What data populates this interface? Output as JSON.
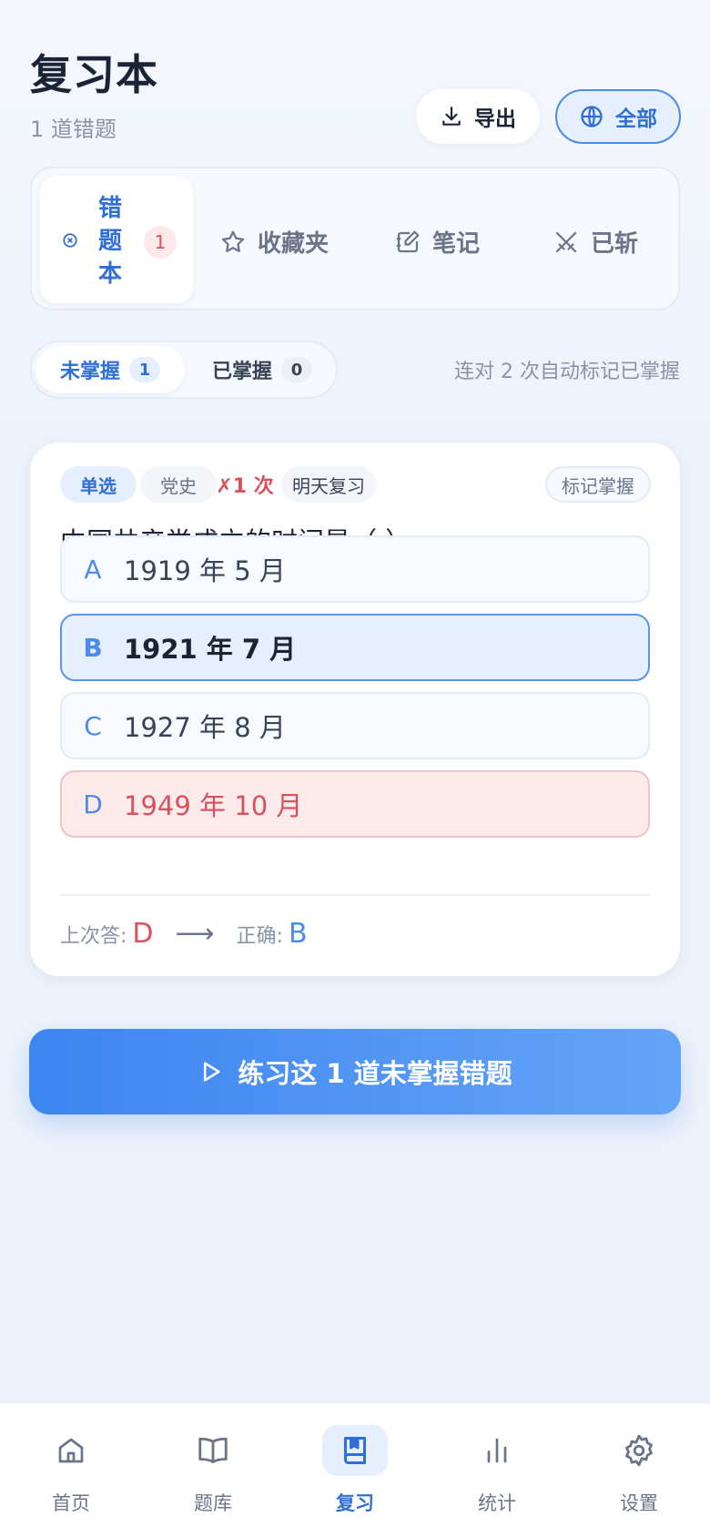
{
  "header": {
    "title": "复习本",
    "subtitle": "1 道错题",
    "export_label": "导出",
    "filter_label": "全部"
  },
  "tabs": {
    "active": {
      "label": "错题本",
      "count": "1",
      "icon": "x-circle-icon"
    },
    "items": [
      {
        "label": "收藏夹",
        "icon": "star-icon"
      },
      {
        "label": "笔记",
        "icon": "edit-icon"
      },
      {
        "label": "已斩",
        "icon": "crossed-swords-icon"
      }
    ]
  },
  "mastery_filter": {
    "unmastered_label": "未掌握",
    "unmastered_count": "1",
    "mastered_label": "已掌握",
    "mastered_count": "0",
    "hint": "连对 2 次自动标记已掌握"
  },
  "question": {
    "type_tag": "单选",
    "subject_tag": "党史",
    "wrong_count": "✗1 次",
    "review_tag": "明天复习",
    "mark_label": "标记掌握",
    "text": "中国共产党成立的时间是（ ）。",
    "options": [
      {
        "letter": "A",
        "text": "1919 年 5 月",
        "state": "normal"
      },
      {
        "letter": "B",
        "text": "1921 年 7 月",
        "state": "correct"
      },
      {
        "letter": "C",
        "text": "1927 年 8 月",
        "state": "normal"
      },
      {
        "letter": "D",
        "text": "1949 年 10 月",
        "state": "wrong"
      }
    ],
    "last_answer_label": "上次答:",
    "last_answer": "D",
    "correct_label": "正确:",
    "correct_answer": "B"
  },
  "practice_button": {
    "label": "练习这 1 道未掌握错题",
    "icon": "play-icon"
  },
  "nav": {
    "items": [
      {
        "label": "首页",
        "icon": "home-icon"
      },
      {
        "label": "题库",
        "icon": "book-open-icon"
      },
      {
        "label": "复习",
        "icon": "bookmark-book-icon"
      },
      {
        "label": "统计",
        "icon": "bar-chart-icon"
      },
      {
        "label": "设置",
        "icon": "gear-icon"
      }
    ],
    "active_index": 2
  },
  "colors": {
    "accent": "#2f6fd6",
    "accent_light": "#e6effd",
    "danger": "#d9505e",
    "danger_light": "#fdebec",
    "background": "#eef2fa"
  }
}
